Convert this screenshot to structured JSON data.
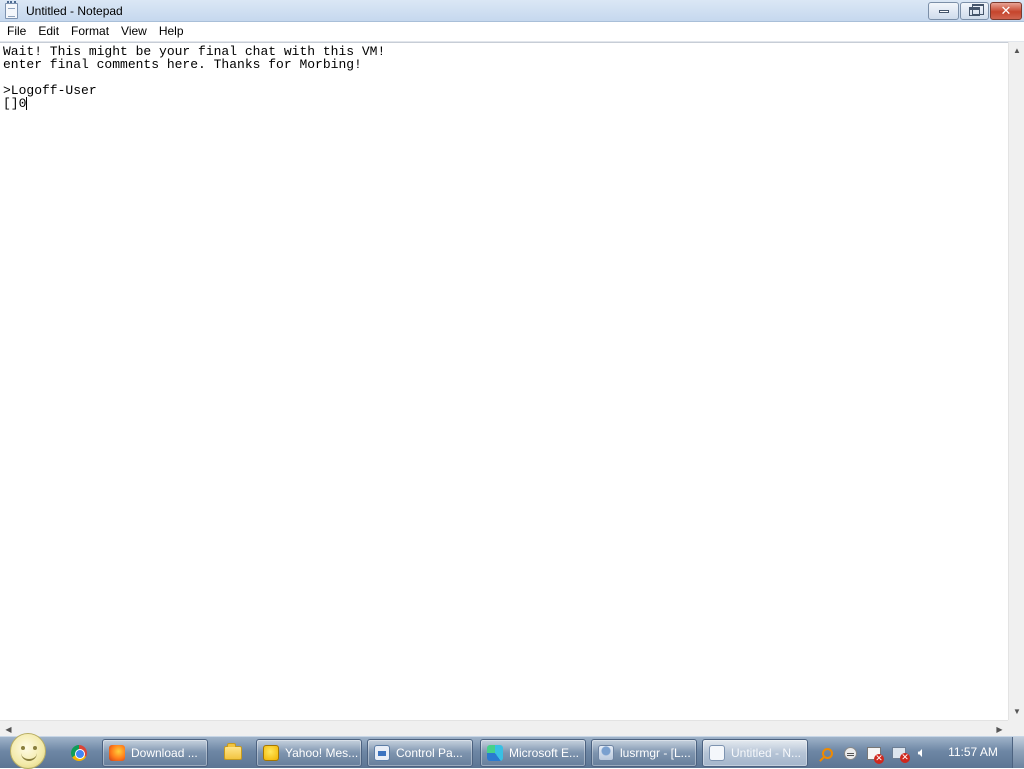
{
  "window": {
    "title": "Untitled - Notepad"
  },
  "menu": {
    "items": [
      "File",
      "Edit",
      "Format",
      "View",
      "Help"
    ]
  },
  "editor": {
    "lines": [
      "Wait! This might be your final chat with this VM!",
      "enter final comments here. Thanks for Morbing!",
      "",
      ">Logoff-User",
      "[]0"
    ]
  },
  "taskbar": {
    "pinned": [
      {
        "name": "chrome",
        "icon": "chrome-icon"
      },
      {
        "name": "explorer",
        "icon": "folder-icon"
      }
    ],
    "tasks": [
      {
        "label": "Download ...",
        "icon": "firefox-icon"
      },
      {
        "label": "Yahoo! Mes...",
        "icon": "yahoo-messenger-icon"
      },
      {
        "label": "Control Pa...",
        "icon": "control-panel-icon"
      },
      {
        "label": "Microsoft E...",
        "icon": "edge-icon"
      },
      {
        "label": "lusrmgr - [L...",
        "icon": "lusrmgr-icon"
      },
      {
        "label": "Untitled - N...",
        "icon": "notepad-icon",
        "active": true
      }
    ],
    "tray_icons": [
      "search-icon",
      "message-icon",
      "action-center-icon",
      "network-icon",
      "volume-icon"
    ],
    "clock": "11:57 AM"
  }
}
